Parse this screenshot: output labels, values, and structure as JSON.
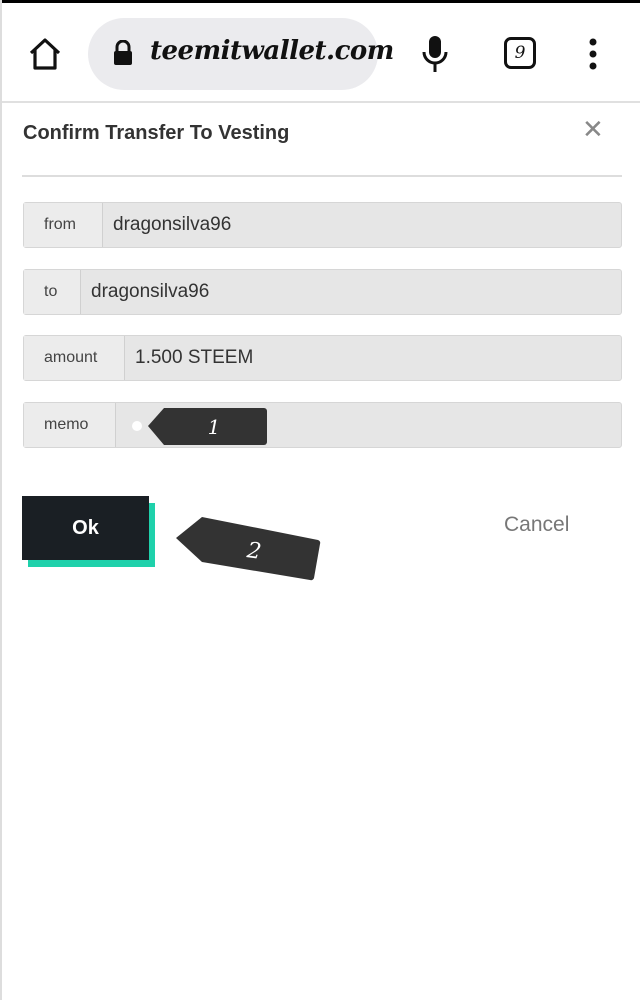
{
  "browser": {
    "url": "teemitwallet.com",
    "tab_count": "9"
  },
  "dialog": {
    "title": "Confirm Transfer To Vesting",
    "fields": [
      {
        "label": "from",
        "value": "dragonsilva96"
      },
      {
        "label": "to",
        "value": "dragonsilva96"
      },
      {
        "label": "amount",
        "value": "1.500 STEEM"
      },
      {
        "label": "memo",
        "value": ""
      }
    ],
    "ok_label": "Ok",
    "cancel_label": "Cancel"
  },
  "annotations": [
    {
      "label": "1"
    },
    {
      "label": "2"
    }
  ],
  "colors": {
    "ok_bg": "#1a1f24",
    "ok_shadow": "#1fd1ab",
    "annotation": "#333333"
  }
}
